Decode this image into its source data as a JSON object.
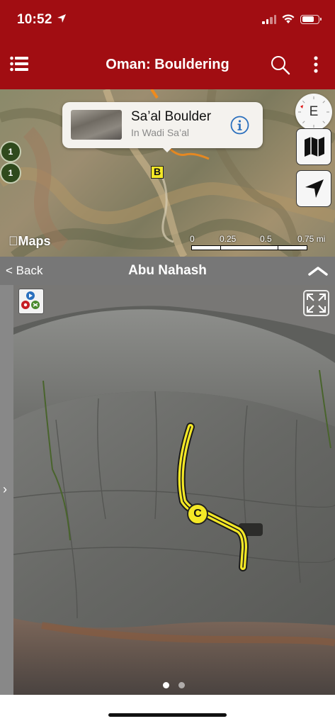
{
  "status_bar": {
    "time": "10:52",
    "location_icon": "location-arrow-icon",
    "signal_icon": "cellular-signal-icon",
    "wifi_icon": "wifi-icon",
    "battery_icon": "battery-icon",
    "battery_level": 0.75
  },
  "header": {
    "menu_icon": "hamburger-menu-icon",
    "title": "Oman: Bouldering",
    "search_icon": "search-icon",
    "more_icon": "more-vertical-icon",
    "background_color": "#a10d12"
  },
  "map": {
    "callout": {
      "name": "Sa’al Boulder",
      "subtitle": "In Wadi Sa’al",
      "info_icon": "info-icon"
    },
    "compass": {
      "heading_letter": "E"
    },
    "layers_icon": "map-layers-icon",
    "locate_icon": "navigation-arrow-icon",
    "markers": {
      "area_label": "B",
      "cluster_1": "1",
      "cluster_2": "1"
    },
    "attribution": "Maps",
    "scale": {
      "labels": [
        "0",
        "0.25",
        "0.5",
        "0.75 mi"
      ]
    }
  },
  "problem": {
    "back_label": "< Back",
    "title": "Abu Nahash",
    "collapse_icon": "chevron-up-icon",
    "side_toggle": "›",
    "legend_icon": "grade-legend-icon",
    "expand_icon": "fullscreen-icon",
    "route_label": "C",
    "route_color": "#f4e826",
    "photo_page": {
      "current": 1,
      "total": 2
    }
  }
}
